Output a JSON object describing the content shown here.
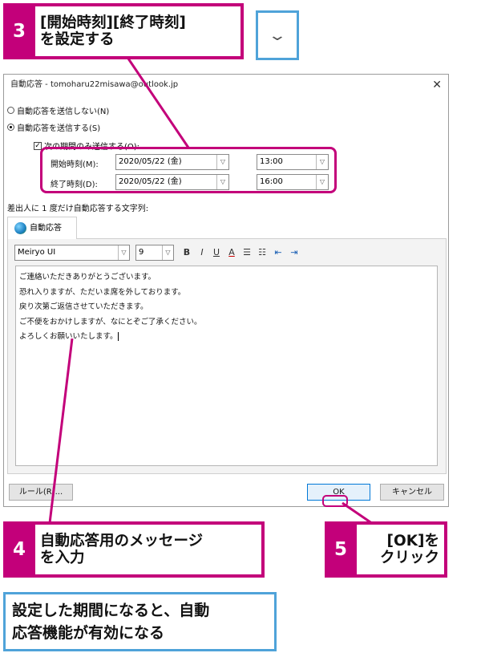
{
  "dialog": {
    "title": "自動応答 - tomoharu22misawa@outlook.jp",
    "close": "✕",
    "radio_off": "自動応答を送信しない(N)",
    "radio_on": "自動応答を送信する(S)",
    "period_checkbox": "次の期間のみ送信する(O):",
    "start_label": "開始時刻(M):",
    "start_date": "2020/05/22 (金)",
    "start_time": "13:00",
    "end_label": "終了時刻(D):",
    "end_date": "2020/05/22 (金)",
    "end_time": "16:00",
    "senders_label": "差出人に 1 度だけ自動応答する文字列:",
    "tab_label": "自動応答",
    "font_name": "Meiryo UI",
    "font_size": "9",
    "message_lines": [
      "ご連絡いただきありがとうございます。",
      "恐れ入りますが、ただいま席を外しております。",
      "戻り次第ご返信させていただきます。",
      "ご不便をおかけしますが、なにとぞご了承ください。",
      "よろしくお願いいたします。"
    ],
    "rules_button": "ルール(R)...",
    "ok_button": "OK",
    "cancel_button": "キャンセル"
  },
  "toolbar_glyphs": {
    "bold": "B",
    "italic": "I",
    "underline": "U",
    "font_color": "A",
    "bullets": "☰",
    "numbering": "☷",
    "outdent": "⇤",
    "indent": "⇥"
  },
  "callouts": {
    "c3": {
      "number": "3",
      "line1": "[開始時刻][終了時刻]",
      "line2": "を設定する"
    },
    "c4": {
      "number": "4",
      "line1": "自動応答用のメッセージ",
      "line2": "を入力"
    },
    "c5": {
      "number": "5",
      "line1": "[OK]を",
      "line2": "クリック"
    }
  },
  "note": {
    "line1": "設定した期間になると、自動",
    "line2": "応答機能が有効になる"
  },
  "dropdown_glyph": "⌄",
  "arrow_glyph": "▽",
  "colors": {
    "magenta": "#c3007a",
    "blue": "#4fa3d9"
  }
}
